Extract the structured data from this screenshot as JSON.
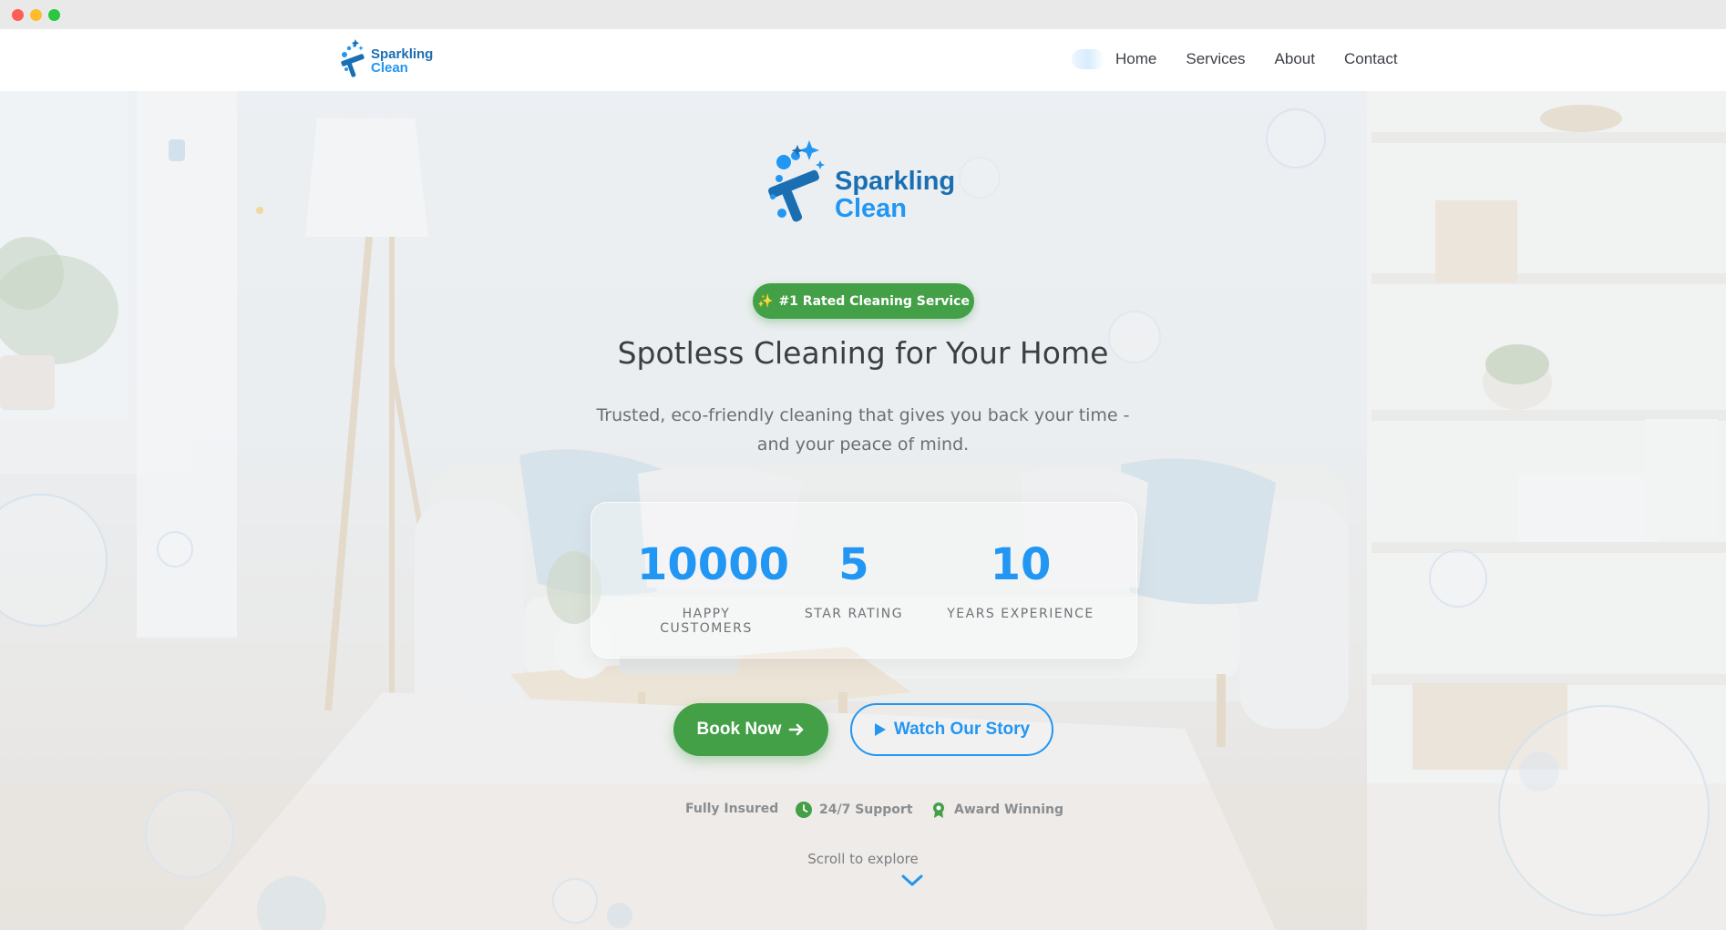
{
  "nav": {
    "logo_line1": "Sparkling",
    "logo_line2": "Clean",
    "links": [
      "Home",
      "Services",
      "About",
      "Contact"
    ]
  },
  "hero": {
    "logo_line1": "Sparkling",
    "logo_line2": "Clean",
    "badge_icon": "✨",
    "badge_text": "#1 Rated Cleaning Service",
    "headline": "Spotless Cleaning for Your Home",
    "subline": "Trusted, eco-friendly cleaning that gives you back your time - and your peace of mind.",
    "stats": [
      {
        "value": "10000",
        "label": "HAPPY CUSTOMERS"
      },
      {
        "value": "5",
        "label": "STAR RATING"
      },
      {
        "value": "10",
        "label": "YEARS EXPERIENCE"
      }
    ],
    "book_button": "Book Now",
    "watch_button": "Watch Our Story",
    "trust": [
      "Fully Insured",
      "24/7 Support",
      "Award Winning"
    ],
    "scroll_text": "Scroll to explore"
  },
  "colors": {
    "brand_blue": "#2196f3",
    "brand_dark_blue": "#1a6fb3",
    "brand_green": "#43a047"
  },
  "icons": [
    "sparkle-icon",
    "arrow-right-icon",
    "play-icon",
    "clock-icon",
    "award-icon",
    "chevron-down-icon"
  ]
}
